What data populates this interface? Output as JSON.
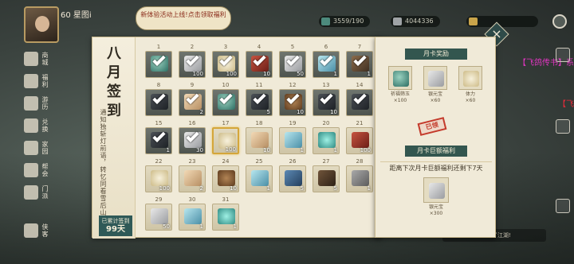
{
  "hud": {
    "level": "60",
    "name": "星图i",
    "vip": "",
    "notice": "新体验活动上线!点击领取福利",
    "resources": [
      {
        "value": "3559/190",
        "icon": "stamina-icon",
        "color": "#4c8a7c"
      },
      {
        "value": "4044336",
        "icon": "silver-icon",
        "color": "#9fa3a6"
      },
      {
        "value": "",
        "icon": "gold-icon",
        "color": "#c9a44a"
      }
    ]
  },
  "leftnav": [
    {
      "label": "商城",
      "icon": "shop-icon"
    },
    {
      "label": "福利",
      "icon": "gift-icon"
    },
    {
      "label": "游历",
      "icon": "travel-icon"
    },
    {
      "label": "兑换",
      "icon": "exchange-icon"
    },
    {
      "label": "家园",
      "icon": "home-icon"
    },
    {
      "label": "帮会",
      "icon": "guild-icon"
    },
    {
      "label": "门派",
      "icon": "sect-icon"
    },
    {
      "label": "侠客",
      "icon": "hero-icon"
    }
  ],
  "chat": {
    "line1": "【飞鸽传书】系",
    "line2": "【飞",
    "bottom": "星图i，欢迎你来到了江湖!"
  },
  "signin": {
    "title": "八月签到",
    "subtitle": "通知独斩灯前语，转忆同看雪后山",
    "total_label": "已累计签到",
    "total_value": "99天",
    "days": [
      {
        "day": "1",
        "item": "jade",
        "qty": "",
        "got": true
      },
      {
        "day": "2",
        "item": "silver",
        "qty": "100",
        "got": true
      },
      {
        "day": "3",
        "item": "bun",
        "qty": "100",
        "got": true
      },
      {
        "day": "4",
        "item": "red",
        "qty": "10",
        "got": true
      },
      {
        "day": "5",
        "item": "silver",
        "qty": "50",
        "got": true
      },
      {
        "day": "6",
        "item": "gem",
        "qty": "1",
        "got": true
      },
      {
        "day": "7",
        "item": "book",
        "qty": "1",
        "got": true
      },
      {
        "day": "8",
        "item": "token",
        "qty": "",
        "got": true
      },
      {
        "day": "9",
        "item": "card",
        "qty": "2",
        "got": true
      },
      {
        "day": "10",
        "item": "jade",
        "qty": "",
        "got": true
      },
      {
        "day": "11",
        "item": "token",
        "qty": "5",
        "got": true
      },
      {
        "day": "12",
        "item": "sack",
        "qty": "10",
        "got": true
      },
      {
        "day": "13",
        "item": "token",
        "qty": "10",
        "got": true
      },
      {
        "day": "14",
        "item": "token",
        "qty": "",
        "got": true
      },
      {
        "day": "15",
        "item": "token",
        "qty": "1",
        "got": true
      },
      {
        "day": "16",
        "item": "silver",
        "qty": "30",
        "got": true
      },
      {
        "day": "17",
        "item": "bun",
        "qty": "100",
        "got": false
      },
      {
        "day": "18",
        "item": "card",
        "qty": "10",
        "got": false
      },
      {
        "day": "19",
        "item": "gem",
        "qty": "1",
        "got": false
      },
      {
        "day": "20",
        "item": "orb",
        "qty": "1",
        "got": false
      },
      {
        "day": "21",
        "item": "red",
        "qty": "100",
        "got": false
      },
      {
        "day": "22",
        "item": "bun",
        "qty": "100",
        "got": false
      },
      {
        "day": "23",
        "item": "card",
        "qty": "2",
        "got": false
      },
      {
        "day": "24",
        "item": "sack",
        "qty": "10",
        "got": false
      },
      {
        "day": "25",
        "item": "gem",
        "qty": "1",
        "got": false
      },
      {
        "day": "26",
        "item": "blue",
        "qty": "5",
        "got": false
      },
      {
        "day": "27",
        "item": "brown",
        "qty": "5",
        "got": false
      },
      {
        "day": "28",
        "item": "hammer",
        "qty": "1",
        "got": false
      },
      {
        "day": "29",
        "item": "silver",
        "qty": "50",
        "got": false
      },
      {
        "day": "30",
        "item": "gem",
        "qty": "1",
        "got": false
      },
      {
        "day": "31",
        "item": "orb",
        "qty": "1",
        "got": false
      }
    ]
  },
  "monthcard": {
    "reward_title": "月卡奖励",
    "rewards": [
      {
        "name": "祈福筛玉",
        "qty": "×100",
        "item": "jade"
      },
      {
        "name": "银元宝",
        "qty": "×60",
        "item": "silver"
      },
      {
        "name": "体力",
        "qty": "×60",
        "item": "bun"
      }
    ],
    "stamp": "已领",
    "big_title": "月卡巨额福利",
    "note": "距离下次月卡巨额福利还剩下7天",
    "big_reward": {
      "name": "银元宝",
      "qty": "×300",
      "item": "silver"
    }
  },
  "close_label": "×"
}
